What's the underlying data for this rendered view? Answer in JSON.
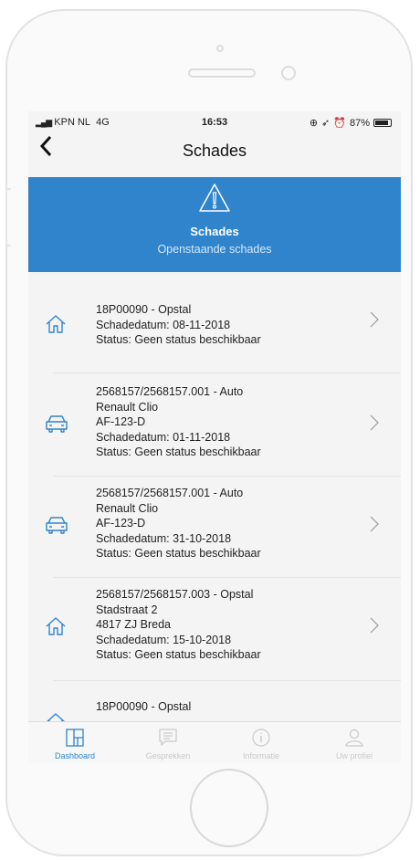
{
  "statusbar": {
    "carrier": "KPN NL",
    "network": "4G",
    "time": "16:53",
    "battery": "87%"
  },
  "navbar": {
    "title": "Schades",
    "back_icon": "chevron-left-icon"
  },
  "banner": {
    "icon": "warning-triangle-icon",
    "title": "Schades",
    "subtitle": "Openstaande schades",
    "color": "#2f84cc"
  },
  "items": [
    {
      "icon": "house-icon",
      "lines": [
        "18P00090 - Opstal",
        "Schadedatum: 08-11-2018",
        "Status: Geen status beschikbaar"
      ]
    },
    {
      "icon": "car-icon",
      "lines": [
        "2568157/2568157.001 - Auto",
        "Renault Clio",
        "AF-123-D",
        "Schadedatum: 01-11-2018",
        "Status: Geen status beschikbaar"
      ]
    },
    {
      "icon": "car-icon",
      "lines": [
        "2568157/2568157.001 - Auto",
        "Renault Clio",
        "AF-123-D",
        "Schadedatum: 31-10-2018",
        "Status: Geen status beschikbaar"
      ]
    },
    {
      "icon": "house-icon",
      "lines": [
        "2568157/2568157.003 - Opstal",
        "Stadstraat 2",
        "4817 ZJ Breda",
        "Schadedatum: 15-10-2018",
        "Status: Geen status beschikbaar"
      ]
    },
    {
      "icon": "house-icon",
      "lines": [
        "18P00090 - Opstal"
      ]
    }
  ],
  "tabs": [
    {
      "label": "Dashboard",
      "icon": "dashboard-icon",
      "active": true
    },
    {
      "label": "Gesprekken",
      "icon": "chat-icon",
      "active": false
    },
    {
      "label": "Informatie",
      "icon": "info-icon",
      "active": false
    },
    {
      "label": "Uw profiel",
      "icon": "profile-icon",
      "active": false
    }
  ]
}
